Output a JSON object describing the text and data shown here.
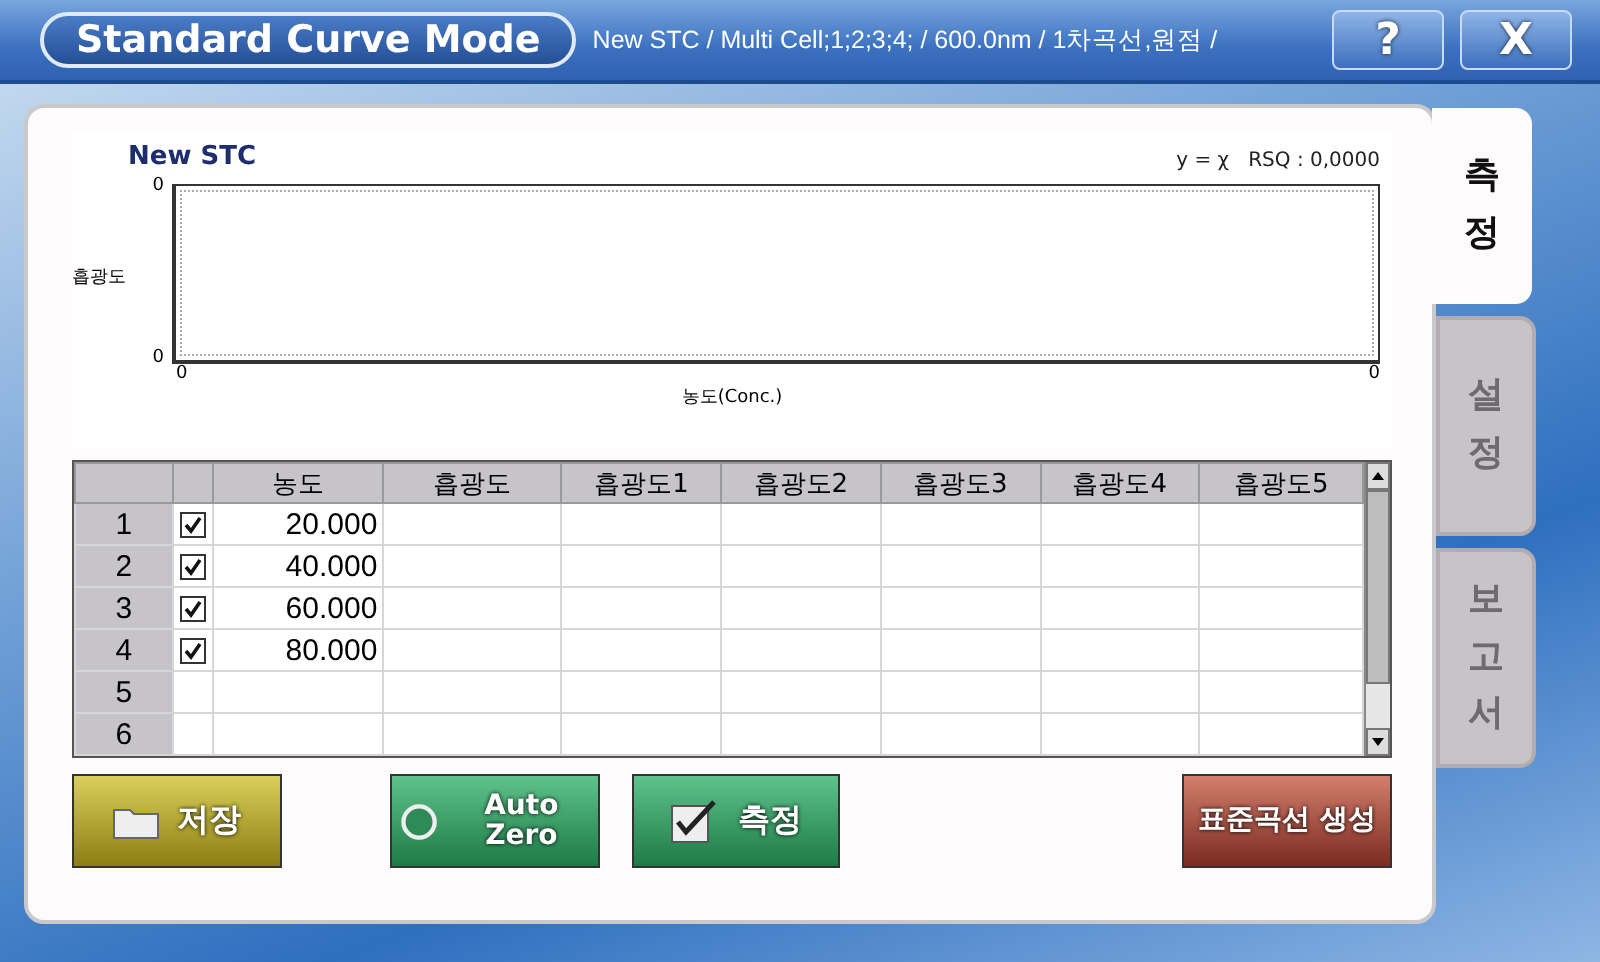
{
  "header": {
    "title": "Standard Curve Mode",
    "subtitle": "New STC / Multi Cell;1;2;3;4; / 600.0nm / 1차곡선,원점 /",
    "buttons": [
      {
        "label": "?"
      },
      {
        "label": "X"
      }
    ]
  },
  "graph": {
    "title": "New STC",
    "equation": "y = χ",
    "rsq": "RSQ : 0,0000",
    "ylabel": "흡광도",
    "xlabel": "농도(Conc.)",
    "y_ticks": [
      "0",
      "0"
    ],
    "x_ticks": [
      "0",
      "0"
    ]
  },
  "table": {
    "columns": [
      "",
      "",
      "농도",
      "흡광도",
      "흡광도1",
      "흡광도2",
      "흡광도3",
      "흡광도4",
      "흡광도5"
    ],
    "rows": [
      {
        "index": "1",
        "checked": true,
        "concentration": "20.000"
      },
      {
        "index": "2",
        "checked": true,
        "concentration": "40.000"
      },
      {
        "index": "3",
        "checked": true,
        "concentration": "60.000"
      },
      {
        "index": "4",
        "checked": true,
        "concentration": "80.000"
      },
      {
        "index": "5"
      },
      {
        "index": "6"
      }
    ]
  },
  "actions": [
    {
      "kind": "save",
      "label": "저장"
    },
    {
      "kind": "autozero",
      "label": "Auto Zero"
    },
    {
      "kind": "measure",
      "label": "측정"
    },
    {
      "kind": "curve",
      "label": "표준곡선 생성"
    }
  ],
  "tabs": [
    {
      "label": "측정",
      "selected": true
    },
    {
      "label": "설정",
      "selected": false
    },
    {
      "label": "보고서",
      "selected": false
    }
  ]
}
